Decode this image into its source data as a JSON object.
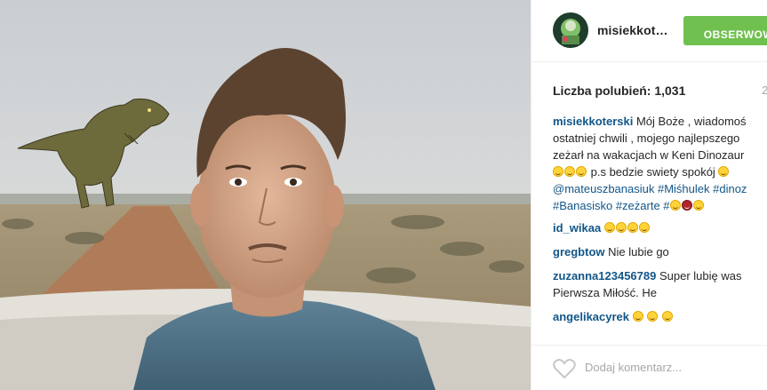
{
  "post": {
    "photo_icon": "selfie-with-dinosaur-photo",
    "username": "misiekkot…",
    "follow_label": "OBSERWOW",
    "likes_label": "Liczba polubień: 1,031",
    "time": "2"
  },
  "comments": [
    {
      "user": "misiekkoterski",
      "lines": [
        "Mój Boże , wiadomoś",
        "ostatniej chwili , mojego najlepszego",
        "zeżarł na wakacjach w Keni Dinozaur",
        "p.s bedzie swiety spokój"
      ],
      "tags_line1": "@mateuszbanasiuk #Miśhulek #dinoz",
      "tags_line2": "#Banasisko #zeżarte #"
    },
    {
      "user": "id_wikaa",
      "text": ""
    },
    {
      "user": "gregbtow",
      "text": "Nie lubie go"
    },
    {
      "user": "zuzanna123456789",
      "text": "Super lubię was",
      "text2": "Pierwsza Miłość. He"
    },
    {
      "user": "angelikacyrek",
      "text": ""
    }
  ],
  "footer": {
    "comment_placeholder": "Dodaj komentarz...",
    "heart_icon": "heart-outline-icon"
  },
  "colors": {
    "follow_green": "#70c050",
    "link_blue": "#125688",
    "muted_gray": "#a5a7aa"
  }
}
